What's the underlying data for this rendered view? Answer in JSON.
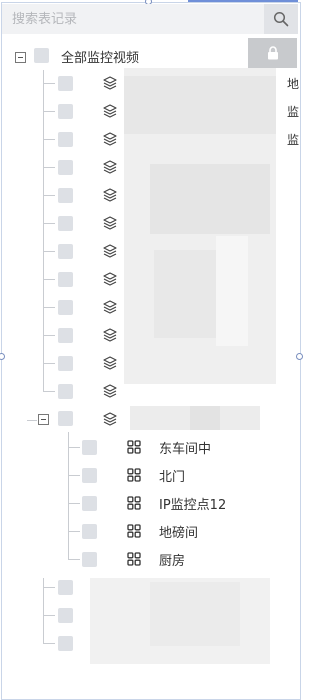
{
  "search": {
    "placeholder": "搜索表记录"
  },
  "tree": {
    "root_label": "全部监控视频",
    "cut_off_fragments": [
      "地",
      "监",
      "监"
    ],
    "child_items": [
      {
        "label": "东车间中"
      },
      {
        "label": "北门"
      },
      {
        "label": "IP监控点12"
      },
      {
        "label": "地磅间"
      },
      {
        "label": "厨房"
      }
    ]
  },
  "icons": {
    "search": "search-icon",
    "lock": "lock-icon",
    "group": "layers-icon",
    "camera": "grid-icon"
  },
  "colors": {
    "checkbox": "#dde0e5",
    "search_bg": "#f1f2f4",
    "lock_bg": "#c8cacd"
  }
}
